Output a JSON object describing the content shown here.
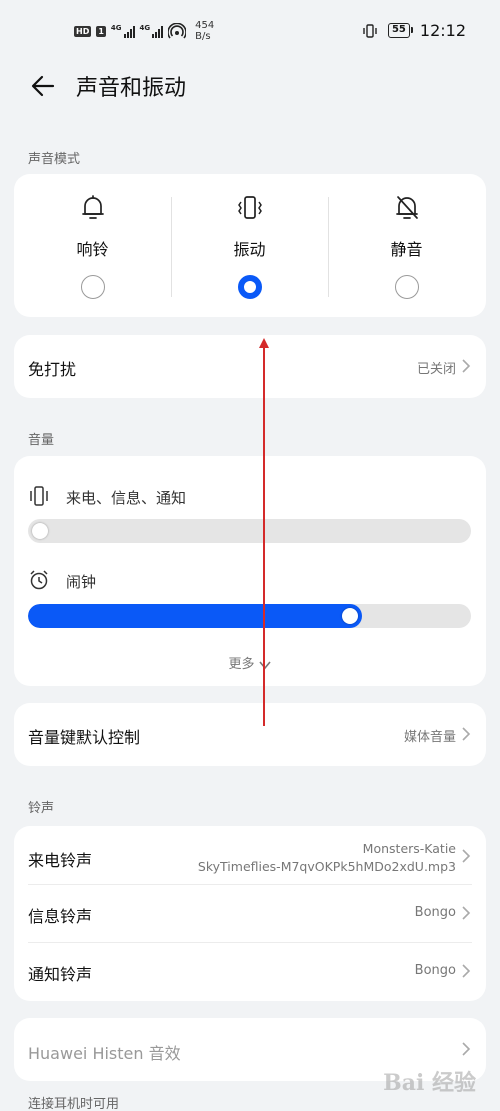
{
  "status_bar": {
    "hd_label": "HD",
    "hd_num": "1",
    "signal1_label": "4G",
    "signal2_label": "4G",
    "speed_value": "454",
    "speed_unit": "B/s",
    "battery": "55",
    "time": "12:12"
  },
  "header": {
    "title": "声音和振动"
  },
  "sound_mode": {
    "section_label": "声音模式",
    "options": [
      {
        "label": "响铃",
        "icon": "bell-icon",
        "selected": false
      },
      {
        "label": "振动",
        "icon": "vibrate-icon",
        "selected": true
      },
      {
        "label": "静音",
        "icon": "bell-off-icon",
        "selected": false
      }
    ]
  },
  "dnd": {
    "label": "免打扰",
    "value": "已关闭"
  },
  "volume": {
    "section_label": "音量",
    "ringer_label": "来电、信息、通知",
    "ringer_level": 0.0,
    "alarm_label": "闹钟",
    "alarm_level": 0.74,
    "more_label": "更多"
  },
  "volume_key": {
    "label": "音量键默认控制",
    "value": "媒体音量"
  },
  "ringtones": {
    "section_label": "铃声",
    "call_label": "来电铃声",
    "call_value_line1": "Monsters-Katie",
    "call_value_line2": "SkyTimeflies-M7qvOKPk5hMDo2xdU.mp3",
    "message_label": "信息铃声",
    "message_value": "Bongo",
    "notification_label": "通知铃声",
    "notification_value": "Bongo"
  },
  "histen": {
    "label": "Huawei Histen 音效"
  },
  "headphones_section_label": "连接耳机时可用",
  "watermark": "Bai 经验",
  "colors": {
    "accent": "#0a59f7",
    "annotation_arrow": "#d42a2a",
    "background": "#f1f3f5"
  }
}
